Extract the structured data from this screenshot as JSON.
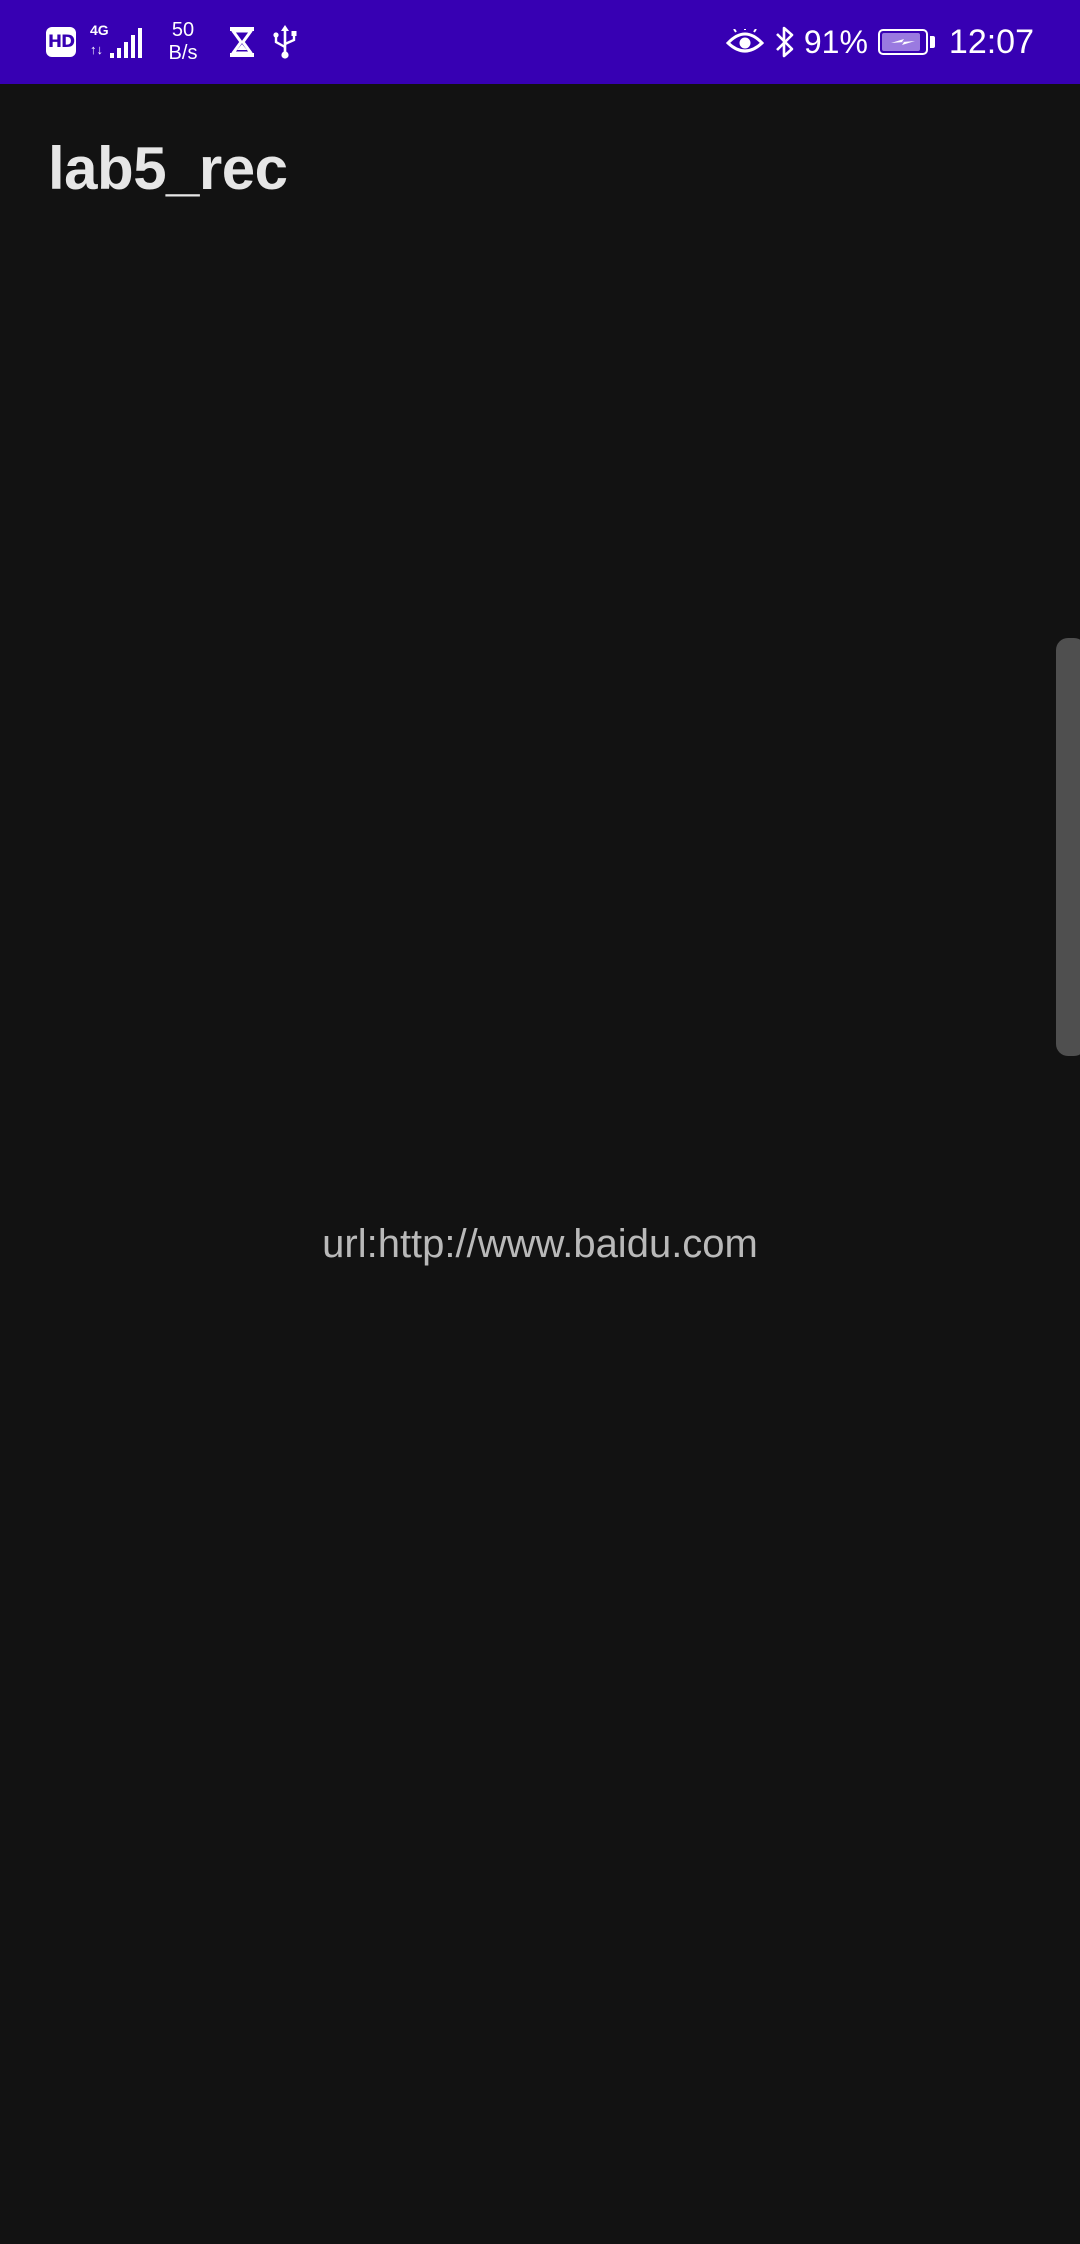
{
  "status_bar": {
    "hd_label": "HD",
    "network_generation": "4G",
    "network_activity": "↑↓",
    "speed_value": "50",
    "speed_unit": "B/s",
    "icons": [
      "hd-icon",
      "signal-icon",
      "hourglass-icon",
      "usb-icon",
      "eye-icon",
      "bluetooth-icon",
      "battery-charging-icon"
    ],
    "battery_percent": "91%",
    "battery_level": 0.91,
    "time": "12:07",
    "background_color": "#3700b3"
  },
  "app_bar": {
    "title": "lab5_rec"
  },
  "content": {
    "url_text": "url:http://www.baidu.com"
  },
  "colors": {
    "background": "#121212",
    "title_text": "#e6e6e6",
    "body_text": "#b9b9b9",
    "edge_handle": "#4f4f4f"
  }
}
